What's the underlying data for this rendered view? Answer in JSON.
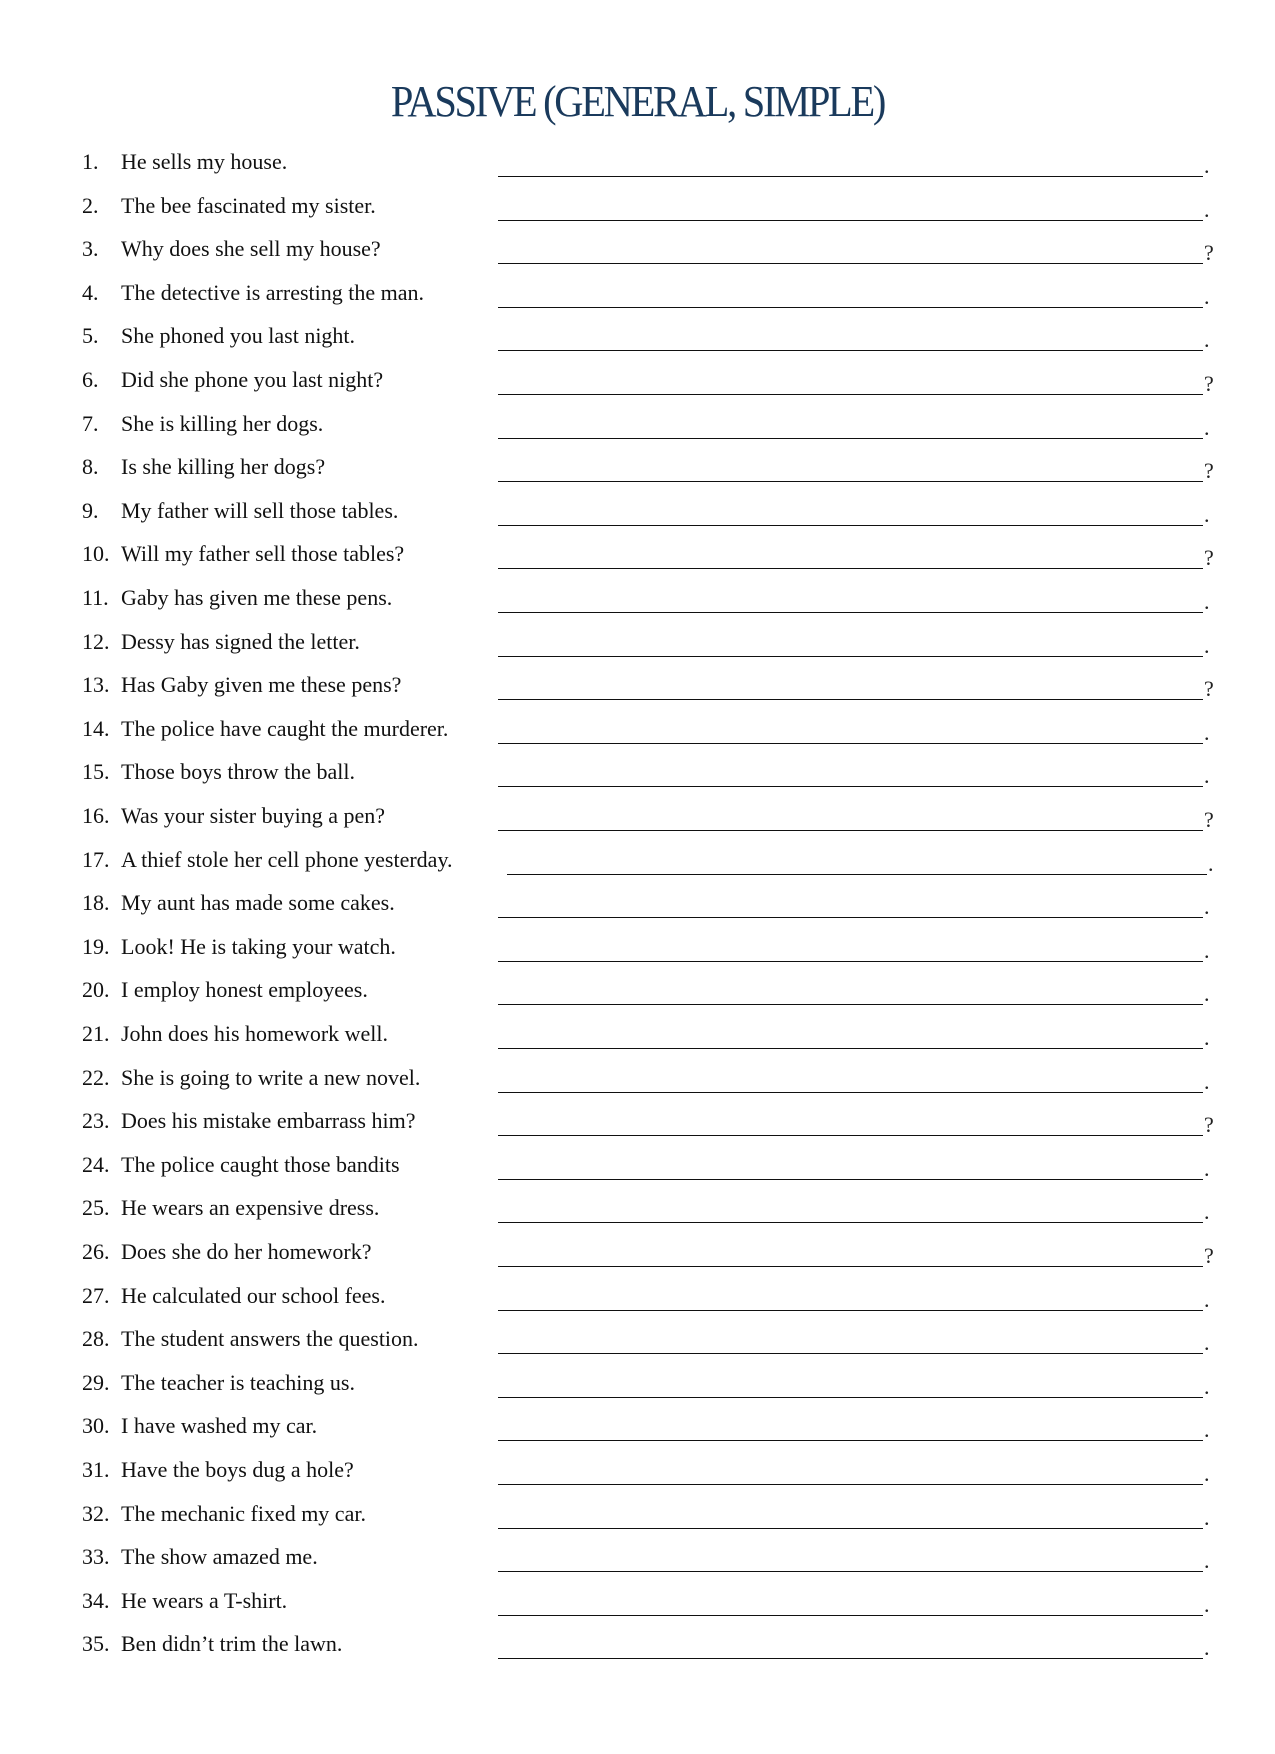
{
  "title": "PASSIVE (GENERAL, SIMPLE)",
  "colors": {
    "title": "#1a3a5c",
    "text": "#111111"
  },
  "items": [
    {
      "num": "1.",
      "text": "He sells my house.",
      "end": "."
    },
    {
      "num": "2.",
      "text": "The bee fascinated my sister.",
      "end": "."
    },
    {
      "num": "3.",
      "text": "Why does she sell my house?",
      "end": "?"
    },
    {
      "num": "4.",
      "text": "The detective is arresting the man.",
      "end": "."
    },
    {
      "num": "5.",
      "text": "She phoned you last night.",
      "end": "."
    },
    {
      "num": "6.",
      "text": "Did she phone you last night?",
      "end": "?"
    },
    {
      "num": "7.",
      "text": "She is killing her dogs.",
      "end": "."
    },
    {
      "num": "8.",
      "text": "Is she killing her dogs?",
      "end": "?"
    },
    {
      "num": "9.",
      "text": "My father will sell those tables.",
      "end": "."
    },
    {
      "num": "10.",
      "text": "Will my father sell those tables?",
      "end": "?"
    },
    {
      "num": "11.",
      "text": "Gaby has given me these pens.",
      "end": "."
    },
    {
      "num": "12.",
      "text": "Dessy has signed the letter.",
      "end": "."
    },
    {
      "num": "13.",
      "text": "Has Gaby given me these pens?",
      "end": "?"
    },
    {
      "num": "14.",
      "text": "The police have caught the murderer.",
      "end": "."
    },
    {
      "num": "15.",
      "text": "Those boys throw the ball.",
      "end": "."
    },
    {
      "num": "16.",
      "text": "Was your sister buying a pen?",
      "end": "?"
    },
    {
      "num": "17.",
      "text": "A thief stole her cell phone yesterday.",
      "end": "."
    },
    {
      "num": "18.",
      "text": "My aunt has made some cakes.",
      "end": "."
    },
    {
      "num": "19.",
      "text": "Look! He is taking your watch.",
      "end": "."
    },
    {
      "num": "20.",
      "text": "I employ honest employees.",
      "end": "."
    },
    {
      "num": "21.",
      "text": "John does his homework well.",
      "end": "."
    },
    {
      "num": "22.",
      "text": "She is going to write a new novel.",
      "end": "."
    },
    {
      "num": "23.",
      "text": "Does his mistake embarrass him?",
      "end": "?"
    },
    {
      "num": "24.",
      "text": "The police caught those bandits",
      "end": "."
    },
    {
      "num": "25.",
      "text": "He wears an expensive dress.",
      "end": "."
    },
    {
      "num": "26.",
      "text": "Does she do her homework?",
      "end": "?"
    },
    {
      "num": "27.",
      "text": "He calculated our school fees.",
      "end": "."
    },
    {
      "num": "28.",
      "text": "The student answers the question.",
      "end": "."
    },
    {
      "num": "29.",
      "text": "The teacher is teaching us.",
      "end": "."
    },
    {
      "num": "30.",
      "text": "I have washed my car.",
      "end": "."
    },
    {
      "num": "31.",
      "text": "Have the boys dug a hole?",
      "end": "."
    },
    {
      "num": "32.",
      "text": "The mechanic fixed my car.",
      "end": "."
    },
    {
      "num": "33.",
      "text": "The show amazed me.",
      "end": "."
    },
    {
      "num": "34.",
      "text": "He wears a T-shirt.",
      "end": "."
    },
    {
      "num": "35.",
      "text": "Ben didn’t trim the lawn.",
      "end": "."
    }
  ]
}
